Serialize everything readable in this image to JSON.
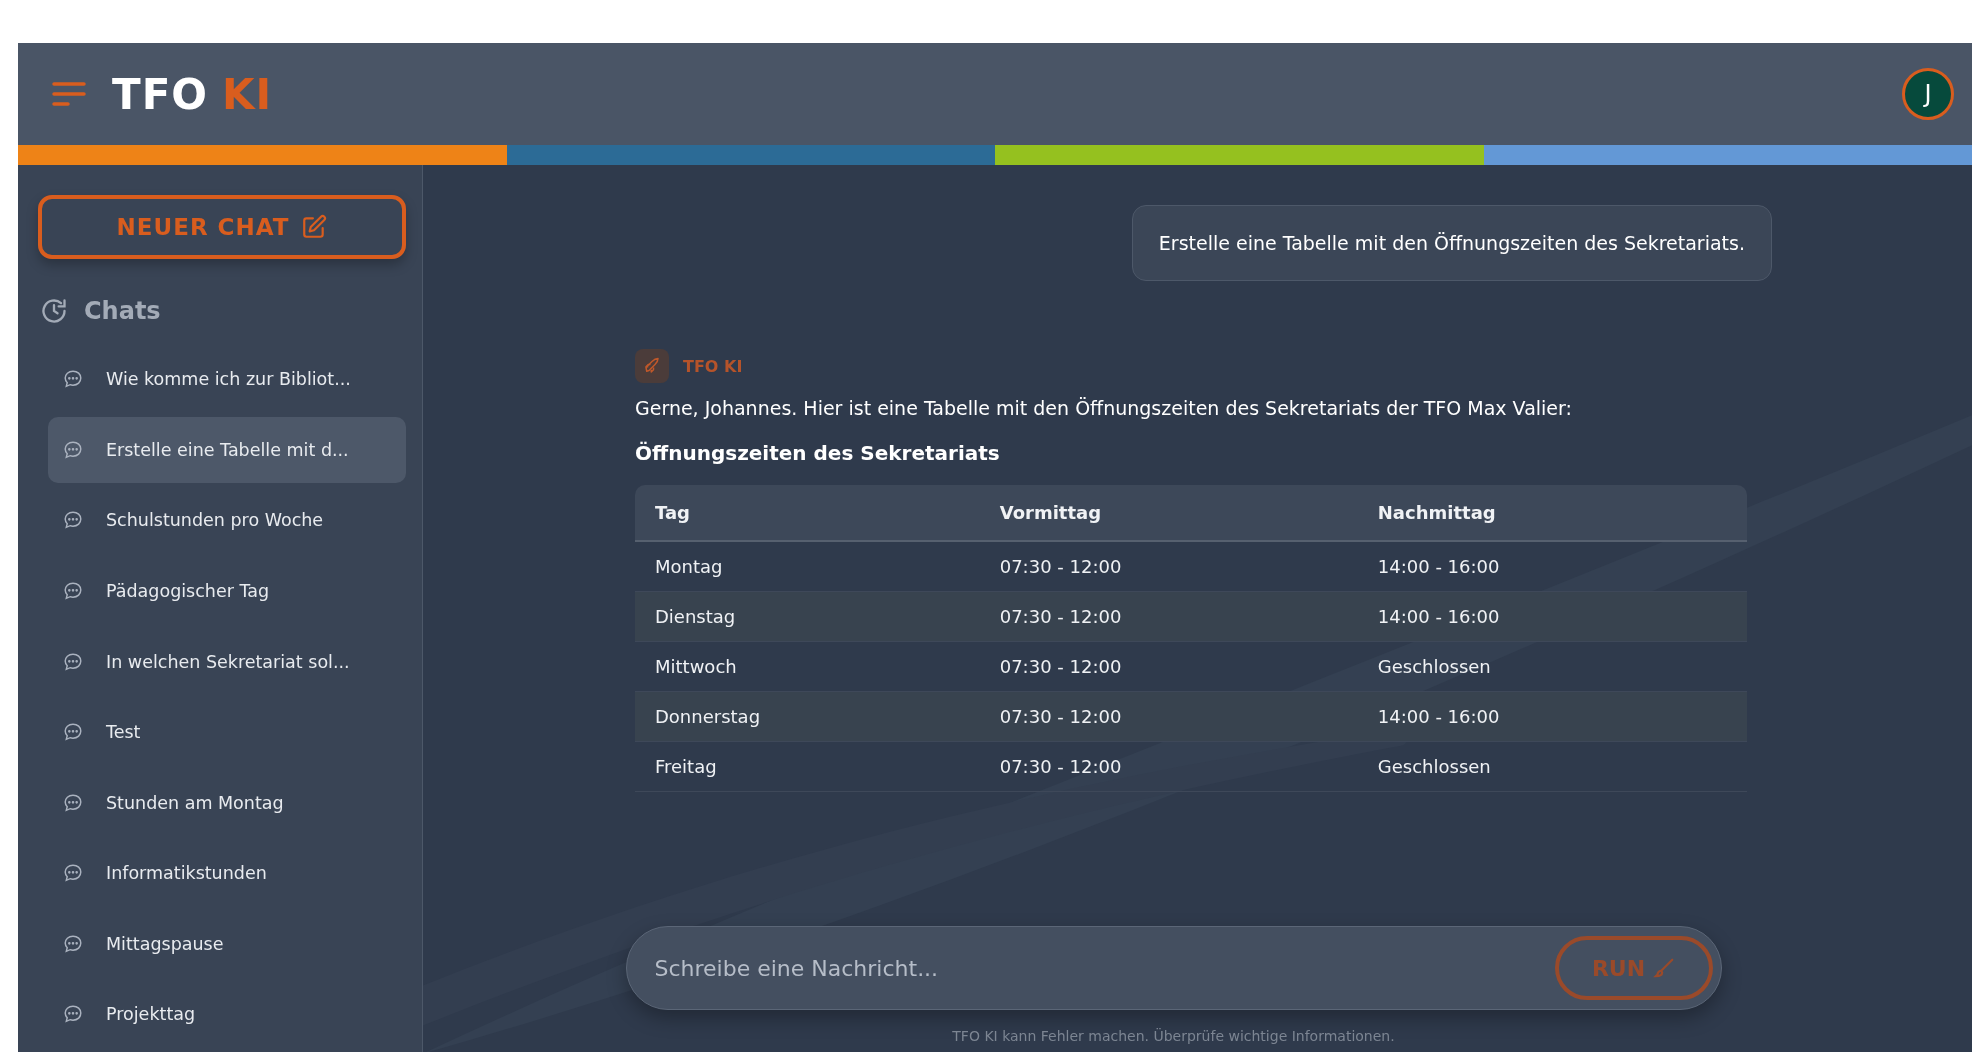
{
  "header": {
    "logo": {
      "text": "TFO",
      "accent": "KI"
    },
    "avatar": "J"
  },
  "color_bar": [
    {
      "color": "#ee8317"
    },
    {
      "color": "#2c6b96"
    },
    {
      "color": "#95c11f"
    },
    {
      "color": "#6398d6"
    }
  ],
  "sidebar": {
    "new_chat": "NEUER CHAT",
    "section": "Chats",
    "items": [
      {
        "label": "Wie komme ich zur Bibliot...",
        "selected": false
      },
      {
        "label": "Erstelle eine Tabelle mit d...",
        "selected": true
      },
      {
        "label": "Schulstunden pro Woche",
        "selected": false
      },
      {
        "label": "Pädagogischer Tag",
        "selected": false
      },
      {
        "label": "In welchen Sekretariat sol...",
        "selected": false
      },
      {
        "label": "Test",
        "selected": false
      },
      {
        "label": "Stunden am Montag",
        "selected": false
      },
      {
        "label": "Informatikstunden",
        "selected": false
      },
      {
        "label": "Mittagspause",
        "selected": false
      },
      {
        "label": "Projekttag",
        "selected": false
      }
    ]
  },
  "chat": {
    "user_message": "Erstelle eine Tabelle mit den Öffnungszeiten des Sekretariats.",
    "assistant": {
      "name": "TFO KI",
      "intro": "Gerne, Johannes. Hier ist eine Tabelle mit den Öffnungszeiten des Sekretariats der TFO Max Valier:",
      "heading": "Öffnungszeiten des Sekretariats",
      "table": {
        "columns": [
          "Tag",
          "Vormittag",
          "Nachmittag"
        ],
        "rows": [
          [
            "Montag",
            "07:30 - 12:00",
            "14:00 - 16:00"
          ],
          [
            "Dienstag",
            "07:30 - 12:00",
            "14:00 - 16:00"
          ],
          [
            "Mittwoch",
            "07:30 - 12:00",
            "Geschlossen"
          ],
          [
            "Donnerstag",
            "07:30 - 12:00",
            "14:00 - 16:00"
          ],
          [
            "Freitag",
            "07:30 - 12:00",
            "Geschlossen"
          ]
        ]
      }
    }
  },
  "input": {
    "placeholder": "Schreibe eine Nachricht...",
    "send": "RUN"
  },
  "footer": "TFO KI kann Fehler machen. Überprüfe wichtige Informationen."
}
